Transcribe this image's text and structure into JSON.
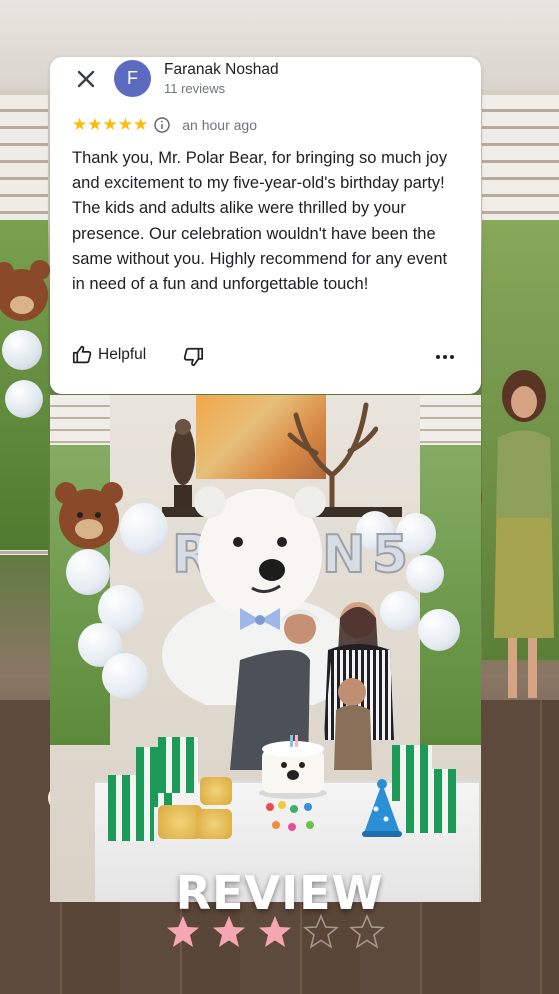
{
  "review": {
    "reviewer_name": "Faranak Noshad",
    "avatar_initial": "F",
    "review_count": "11 reviews",
    "rating": 5,
    "time_ago": "an hour ago",
    "text": "Thank you, Mr. Polar Bear, for bringing so much joy and excitement to my five-year-old's birthday party! The kids and adults alike were thrilled by your presence. Our celebration wouldn't have been the same without you. Highly recommend for any event in need of a fun and unforgettable touch!",
    "helpful_label": "Helpful",
    "icons": {
      "close": "close-icon",
      "info": "info-icon",
      "helpful": "thumbs-up-icon",
      "not_helpful": "thumbs-down-icon",
      "more": "more-options-icon"
    }
  },
  "photo": {
    "balloon_letters": [
      "R",
      "N",
      "5"
    ],
    "description_colors": {
      "bag": "#1b9a58",
      "hat": "#2b8fd6"
    }
  },
  "overlay": {
    "heading": "REVIEW",
    "stars_filled": 3,
    "stars_total": 5
  },
  "colors": {
    "star": "#fbbc04",
    "avatar": "#5c6bc0",
    "bottom_star_filled": "#f4a7b3"
  }
}
